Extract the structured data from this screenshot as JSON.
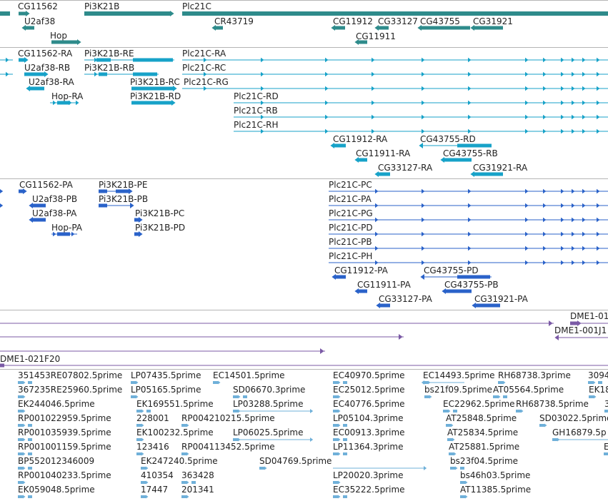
{
  "colors": {
    "gene": "#2e8b8b",
    "mrna": "#17a2c8",
    "protein": "#2a62c9",
    "contig": "#7b5aa6",
    "est": "#6fb0d9",
    "separator": "#b5b5b5"
  },
  "tracks": {
    "genes": [
      {
        "label": "CG11562"
      },
      {
        "label": "Pi3K21B"
      },
      {
        "label": "Plc21C"
      },
      {
        "label": "U2af38"
      },
      {
        "label": "CR43719"
      },
      {
        "label": "CG11912"
      },
      {
        "label": "CG33127"
      },
      {
        "label": "CG43755"
      },
      {
        "label": "CG31921"
      },
      {
        "label": "Hop"
      },
      {
        "label": "CG11911"
      }
    ],
    "mrna": [
      {
        "label": "CG11562-RA"
      },
      {
        "label": "Pi3K21B-RE"
      },
      {
        "label": "Plc21C-RA"
      },
      {
        "label": "U2af38-RB"
      },
      {
        "label": "Pi3K21B-RB"
      },
      {
        "label": "Plc21C-RC"
      },
      {
        "label": "U2af38-RA"
      },
      {
        "label": "Pi3K21B-RC"
      },
      {
        "label": "Plc21C-RG"
      },
      {
        "label": "Hop-RA"
      },
      {
        "label": "Pi3K21B-RD"
      },
      {
        "label": "Plc21C-RD"
      },
      {
        "label": "Plc21C-RB"
      },
      {
        "label": "Plc21C-RH"
      },
      {
        "label": "CG11912-RA"
      },
      {
        "label": "CG43755-RD"
      },
      {
        "label": "CG11911-RA"
      },
      {
        "label": "CG43755-RB"
      },
      {
        "label": "CG33127-RA"
      },
      {
        "label": "CG31921-RA"
      }
    ],
    "proteins": [
      {
        "label": "CG11562-PA"
      },
      {
        "label": "Pi3K21B-PE"
      },
      {
        "label": "Plc21C-PC"
      },
      {
        "label": "U2af38-PB"
      },
      {
        "label": "Pi3K21B-PB"
      },
      {
        "label": "Plc21C-PA"
      },
      {
        "label": "U2af38-PA"
      },
      {
        "label": "Pi3K21B-PC"
      },
      {
        "label": "Plc21C-PG"
      },
      {
        "label": "Hop-PA"
      },
      {
        "label": "Pi3K21B-PD"
      },
      {
        "label": "Plc21C-PD"
      },
      {
        "label": "Plc21C-PB"
      },
      {
        "label": "Plc21C-PH"
      },
      {
        "label": "CG11912-PA"
      },
      {
        "label": "CG43755-PD"
      },
      {
        "label": "CG11911-PA"
      },
      {
        "label": "CG43755-PB"
      },
      {
        "label": "CG33127-PA"
      },
      {
        "label": "CG31921-PA"
      }
    ],
    "contigs": [
      {
        "label": "DME1-01"
      },
      {
        "label": "DME1-001J1"
      },
      {
        "label": "DME1-021F20"
      }
    ],
    "ests": [
      {
        "label": "351453RE07802.5prime"
      },
      {
        "label": "LP07435.5prime"
      },
      {
        "label": "EC14501.5prime"
      },
      {
        "label": "EC40970.5prime"
      },
      {
        "label": "EC14493.5prime"
      },
      {
        "label": "RH68738.3prime"
      },
      {
        "label": "3094"
      },
      {
        "label": "367235RE25960.5prime"
      },
      {
        "label": "LP05165.5prime"
      },
      {
        "label": "SD06670.3prime"
      },
      {
        "label": "EC25012.5prime"
      },
      {
        "label": "bs21f09.5prime"
      },
      {
        "label": "AT05564.5prime"
      },
      {
        "label": "EK18"
      },
      {
        "label": "EK244046.5prime"
      },
      {
        "label": "EK169551.5prime"
      },
      {
        "label": "LP03288.5prime"
      },
      {
        "label": "EC40776.5prime"
      },
      {
        "label": "EC22962.5prime"
      },
      {
        "label": "RH68738.5prime"
      },
      {
        "label": "3"
      },
      {
        "label": "RP001022959.5prime"
      },
      {
        "label": "228001"
      },
      {
        "label": "RP004210215.5prime"
      },
      {
        "label": "LP05104.3prime"
      },
      {
        "label": "AT25848.5prime"
      },
      {
        "label": "SD03022.5prime"
      },
      {
        "label": "RP001035939.5prime"
      },
      {
        "label": "EK100232.5prime"
      },
      {
        "label": "LP06025.5prime"
      },
      {
        "label": "EC00913.3prime"
      },
      {
        "label": "AT25834.5prime"
      },
      {
        "label": "GH16879.5p"
      },
      {
        "label": "RP001001159.5prime"
      },
      {
        "label": "123416"
      },
      {
        "label": "RP004113452.5prime"
      },
      {
        "label": "LP11364.3prime"
      },
      {
        "label": "AT25881.5prime"
      },
      {
        "label": "E"
      },
      {
        "label": "BP552012346009"
      },
      {
        "label": "EK247240.5prime"
      },
      {
        "label": "SD04769.5prime"
      },
      {
        "label": "bs23f04.5prime"
      },
      {
        "label": "RP001040233.5prime"
      },
      {
        "label": "410354"
      },
      {
        "label": "363428"
      },
      {
        "label": "LP20020.3prime"
      },
      {
        "label": "bs46h03.5prime"
      },
      {
        "label": "EK059048.5prime"
      },
      {
        "label": "17447"
      },
      {
        "label": "201341"
      },
      {
        "label": "EC35222.5prime"
      },
      {
        "label": "AT11385.5prime"
      }
    ]
  }
}
